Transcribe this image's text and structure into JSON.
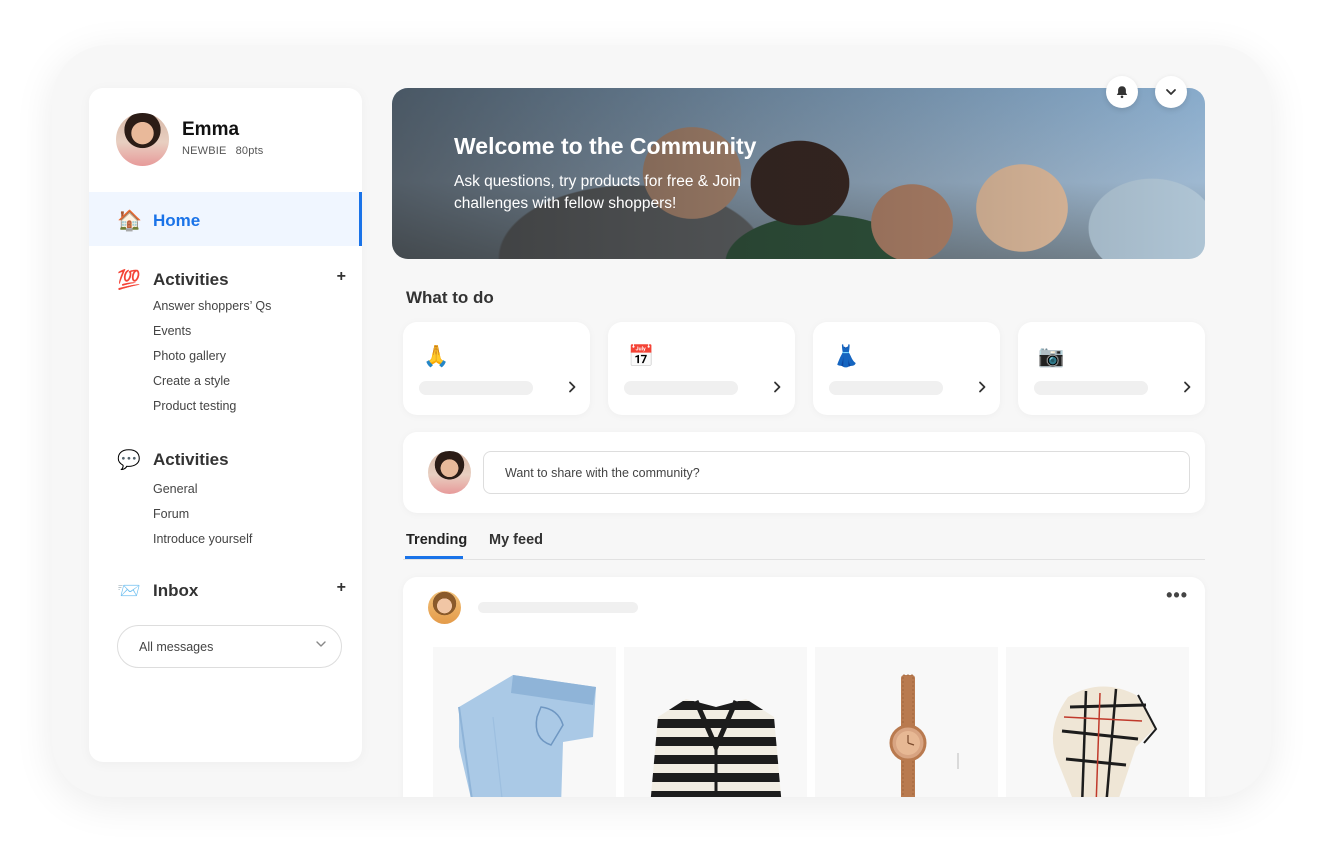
{
  "profile": {
    "name": "Emma",
    "level": "NEWBIE",
    "points": "80pts"
  },
  "nav": {
    "home": {
      "emoji": "🏠",
      "label": "Home"
    },
    "sections": [
      {
        "emoji": "💯",
        "label": "Activities",
        "has_plus": true,
        "items": [
          "Answer shoppers’ Qs",
          "Events",
          "Photo gallery",
          "Create a style",
          "Product testing"
        ]
      },
      {
        "emoji": "💬",
        "label": "Activities",
        "has_plus": false,
        "items": [
          "General",
          "Forum",
          "Introduce yourself"
        ]
      },
      {
        "emoji": "📨",
        "label": "Inbox",
        "has_plus": true,
        "items": []
      }
    ],
    "plus_symbol": "+",
    "messages_filter": "All messages"
  },
  "hero": {
    "title": "Welcome to the Community",
    "subtitle": "Ask questions, try products for free & Join challenges with fellow shoppers!"
  },
  "header_buttons": [
    {
      "name": "notifications",
      "icon": "bell-icon"
    },
    {
      "name": "account-menu",
      "icon": "chevron-down-icon"
    }
  ],
  "what_to_do": {
    "title": "What to do",
    "cards": [
      {
        "emoji": "🙏",
        "icon": "pray-icon"
      },
      {
        "emoji": "📅",
        "icon": "calendar-icon"
      },
      {
        "emoji": "👗",
        "icon": "dress-icon"
      },
      {
        "emoji": "📷",
        "icon": "camera-icon"
      }
    ]
  },
  "composer": {
    "placeholder": "Want to share with the community?"
  },
  "feed_tabs": [
    {
      "label": "Trending",
      "active": true
    },
    {
      "label": "My feed",
      "active": false
    }
  ],
  "post": {
    "menu": "•••",
    "products": [
      "jeans-image",
      "cardigan-image",
      "watch-image",
      "scarf-image"
    ]
  },
  "colors": {
    "accent": "#1a73e8",
    "frame_bg": "#f7f7f7",
    "card_bg": "#ffffff"
  }
}
